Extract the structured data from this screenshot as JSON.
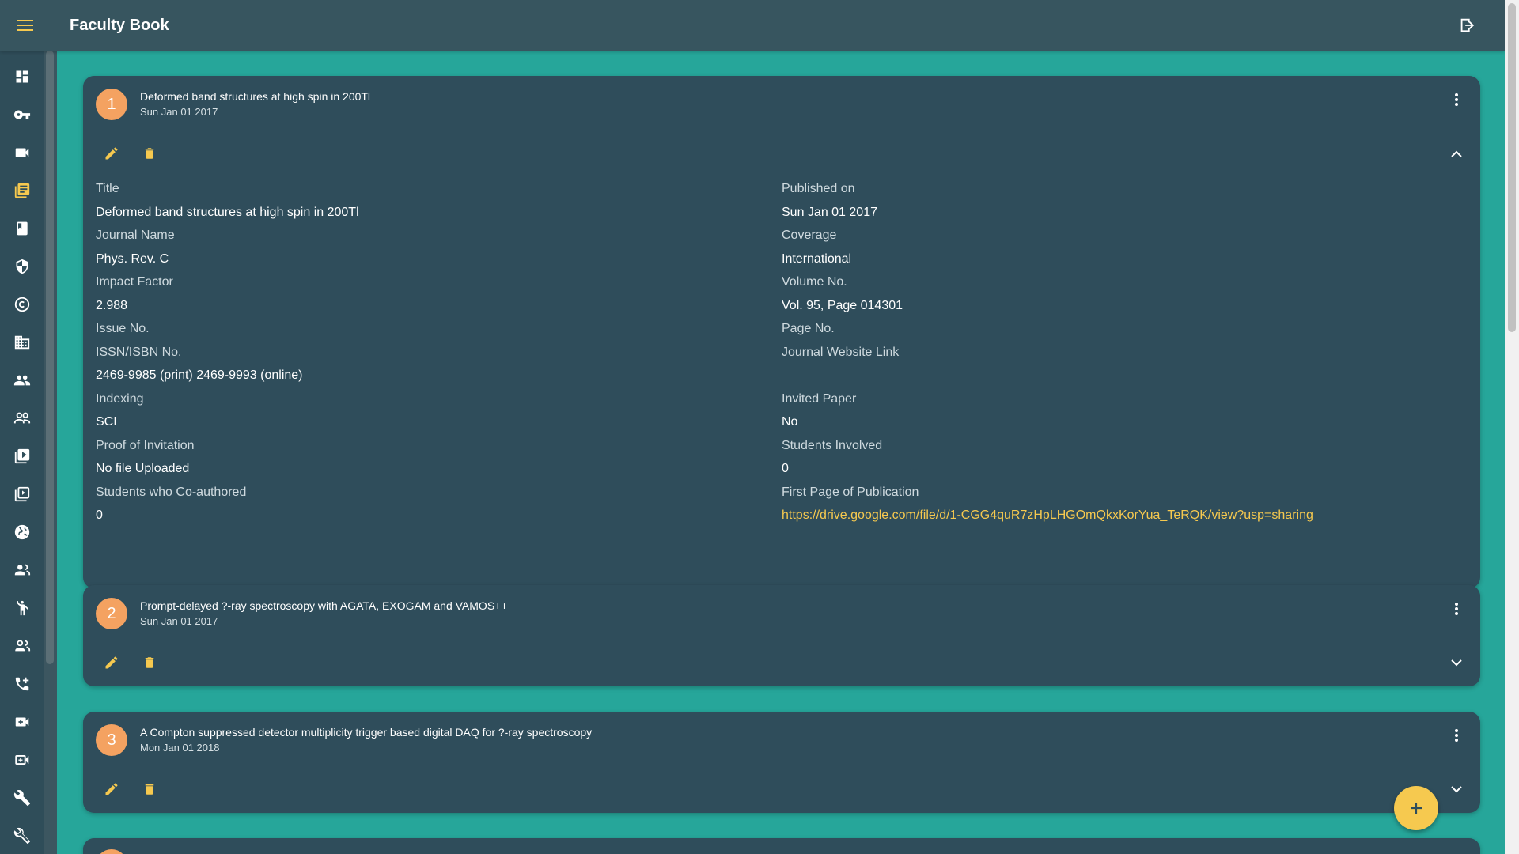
{
  "app": {
    "title": "Faculty Book"
  },
  "colors": {
    "teal_background": "#26a69a",
    "appbar": "#37555f",
    "card": "#2f4d5b",
    "accent_yellow": "#f6c94f",
    "badge_orange": "#f4a261"
  },
  "sidebar": {
    "items": [
      {
        "icon": "dashboard-icon"
      },
      {
        "icon": "key-icon"
      },
      {
        "icon": "videocam-icon"
      },
      {
        "icon": "library-books-icon"
      },
      {
        "icon": "book-icon"
      },
      {
        "icon": "security-shield-icon"
      },
      {
        "icon": "copyright-icon"
      },
      {
        "icon": "business-icon"
      },
      {
        "icon": "people-icon"
      },
      {
        "icon": "people-outline-icon"
      },
      {
        "icon": "video-library-icon"
      },
      {
        "icon": "video-library-outline-icon"
      },
      {
        "icon": "globe-icon"
      },
      {
        "icon": "group-icon"
      },
      {
        "icon": "accessibility-icon"
      },
      {
        "icon": "group-outline-icon"
      },
      {
        "icon": "add-call-icon"
      },
      {
        "icon": "video-call-icon"
      },
      {
        "icon": "video-call-outline-icon"
      },
      {
        "icon": "build-icon"
      },
      {
        "icon": "build-outline-icon"
      }
    ]
  },
  "publications": [
    {
      "number": "1",
      "title": "Deformed band structures at high spin in 200Tl",
      "date": "Sun Jan 01 2017",
      "expanded": true,
      "details": {
        "left": [
          {
            "label": "Title",
            "value": "Deformed band structures at high spin in 200Tl"
          },
          {
            "label": "Journal Name",
            "value": "Phys. Rev. C"
          },
          {
            "label": "Impact Factor",
            "value": "2.988"
          },
          {
            "label": "Issue No.",
            "value": ""
          },
          {
            "label": "ISSN/ISBN No.",
            "value": "2469-9985 (print) 2469-9993 (online)"
          },
          {
            "label": "Indexing",
            "value": "SCI"
          },
          {
            "label": "Proof of Invitation",
            "value": "No file Uploaded"
          },
          {
            "label": "Students who Co-authored",
            "value": "0"
          }
        ],
        "right": [
          {
            "label": "Published on",
            "value": "Sun Jan 01 2017"
          },
          {
            "label": "Coverage",
            "value": "International"
          },
          {
            "label": "Volume No.",
            "value": "Vol. 95, Page 014301"
          },
          {
            "label": "Page No.",
            "value": ""
          },
          {
            "label": "Journal Website Link",
            "value": ""
          },
          {
            "label": "Invited Paper",
            "value": "No"
          },
          {
            "label": "Students Involved",
            "value": "0"
          },
          {
            "label": "First Page of Publication",
            "value": "https://drive.google.com/file/d/1-CGG4quR7zHpLHGOmQkxKorYua_TeRQK/view?usp=sharing"
          }
        ]
      }
    },
    {
      "number": "2",
      "title": "Prompt-delayed ?-ray spectroscopy with AGATA, EXOGAM and VAMOS++",
      "date": "Sun Jan 01 2017",
      "expanded": false
    },
    {
      "number": "3",
      "title": "A Compton suppressed detector multiplicity trigger based digital DAQ for ?-ray spectroscopy",
      "date": "Mon Jan 01 2018",
      "expanded": false
    }
  ],
  "fab": {
    "label": "+"
  }
}
